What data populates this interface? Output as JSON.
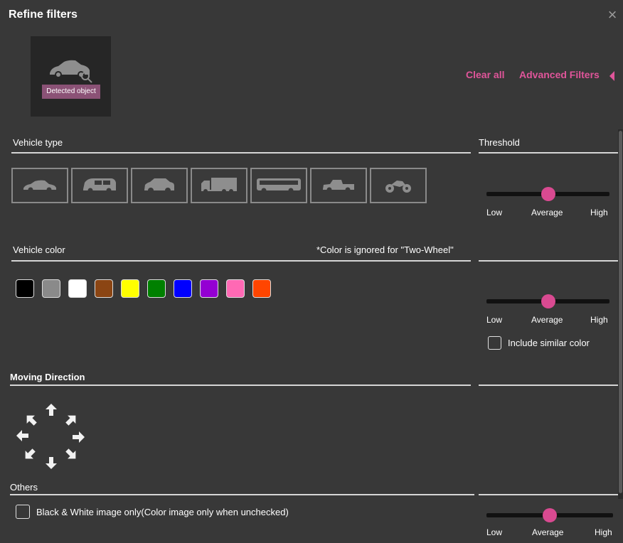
{
  "dialog": {
    "title": "Refine filters",
    "close_icon": "close-icon",
    "detected_object_label": "Detected object",
    "clear_all": "Clear all",
    "advanced_filters": "Advanced Filters",
    "advanced_filters_icon": "triangle-left-icon"
  },
  "vehicle_type": {
    "label": "Vehicle type",
    "items": [
      "sedan-icon",
      "minivan-icon",
      "suv-icon",
      "truck-icon",
      "bus-icon",
      "pickup-icon",
      "motorcycle-icon"
    ]
  },
  "vehicle_color": {
    "label": "Vehicle color",
    "note": "*Color is ignored for \"Two-Wheel\"",
    "colors": [
      "#000000",
      "#8a8a8a",
      "#ffffff",
      "#8b4513",
      "#ffff00",
      "#008000",
      "#0000ff",
      "#9400d3",
      "#ff69b4",
      "#ff4500"
    ]
  },
  "moving_direction": {
    "label": "Moving Direction",
    "arrows": [
      "up",
      "up-right",
      "right",
      "down-right",
      "down",
      "down-left",
      "left",
      "up-left"
    ]
  },
  "others": {
    "label": "Others",
    "bw_checkbox_label": "Black & White image only(Color image only when unchecked)"
  },
  "threshold": {
    "label": "Threshold",
    "sliders": [
      {
        "low": "Low",
        "mid": "Average",
        "high": "High",
        "value": 0.5
      },
      {
        "low": "Low",
        "mid": "Average",
        "high": "High",
        "value": 0.5
      },
      {
        "low": "Low",
        "mid": "Average",
        "high": "High",
        "value": 0.5
      }
    ],
    "similar_color_label": "Include similar color"
  },
  "colors": {
    "accent": "#e0559a",
    "slider_thumb": "#d94a91",
    "badge": "#8b5276",
    "background": "#383838"
  }
}
